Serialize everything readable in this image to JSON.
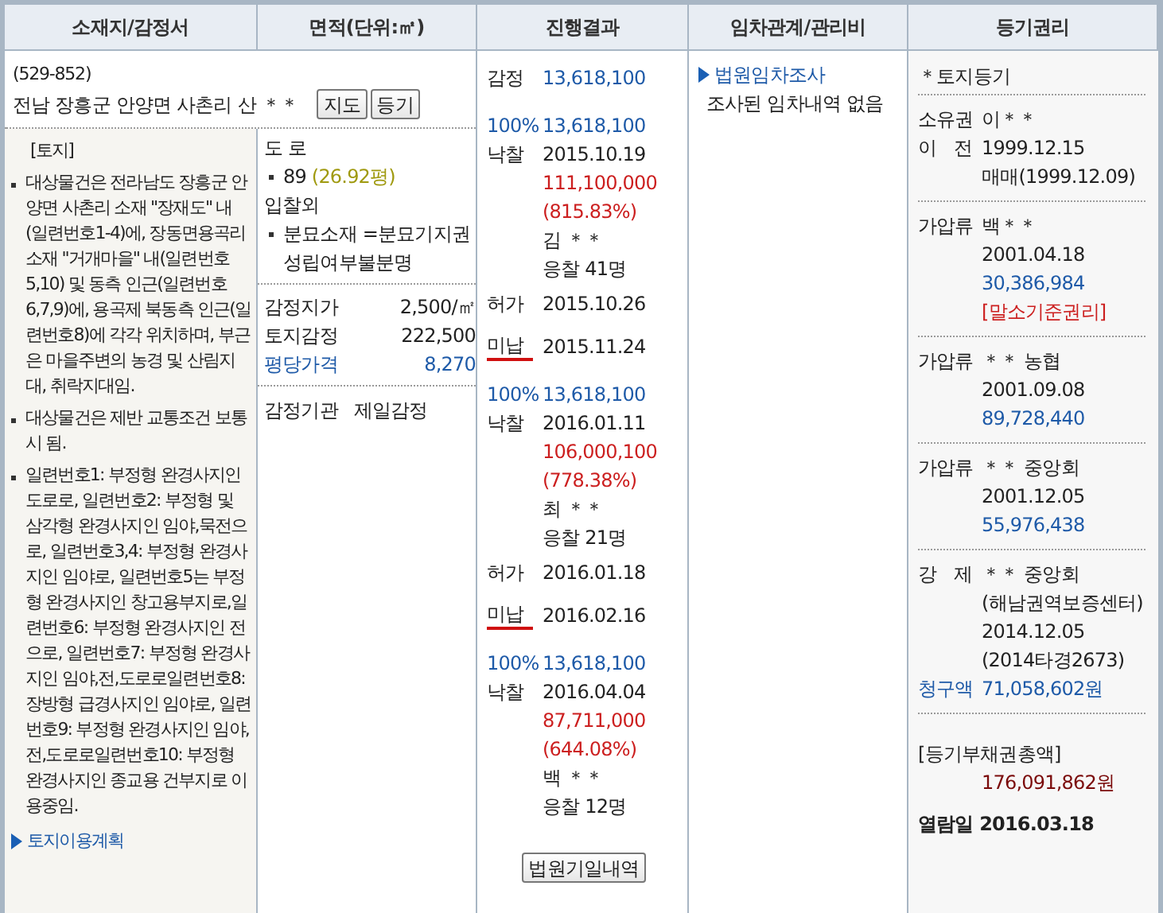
{
  "columns": [
    "소재지/감정서",
    "면적(단위:㎡)",
    "진행결과",
    "임차관계/관리비",
    "등기권리"
  ],
  "address": {
    "zip": "(529-852)",
    "text": "전남 장흥군 안양면 사촌리 산 ＊＊",
    "buttons": [
      "지도",
      "등기"
    ]
  },
  "land": {
    "heading": "[토지]",
    "bullets": [
      "대상물건은 전라남도 장흥군 안양면 사촌리 소재 \"장재도\" 내(일련번호1-4)에, 장동면용곡리 소재 \"거개마을\" 내(일련번호5,10) 및 동측 인근(일련번호6,7,9)에, 용곡제 북동측 인근(일련번호8)에 각각 위치하며, 부근은 마을주변의 농경 및 산림지대, 취락지대임.",
      "대상물건은 제반 교통조건 보통시 됨.",
      "일련번호1: 부정형 완경사지인 도로로, 일련번호2: 부정형 및 삼각형 완경사지인 임야,묵전으로, 일련번호3,4: 부정형 완경사지인 임야로, 일련번호5는 부정형 완경사지인 창고용부지로,일련번호6: 부정형 완경사지인 전으로, 일련번호7: 부정형 완경사지인 임야,전,도로로일련번호8: 장방형 급경사지인 임야로, 일련번호9: 부정형 완경사지인 임야,전,도로로일련번호10: 부정형 완경사지인 종교용 건부지로 이용중임."
    ],
    "link": "토지이용계획"
  },
  "area": {
    "groups": [
      {
        "label": "도 로",
        "items": [
          {
            "text": "89",
            "pyeong": "(26.92평)"
          }
        ]
      },
      {
        "label": "입찰외",
        "items": [
          {
            "text": "분묘소재 =분묘기지권성립여부불분명"
          }
        ]
      }
    ],
    "appraisal": [
      {
        "label": "감정지가",
        "value": "2,500/㎡",
        "kind": "plain"
      },
      {
        "label": "토지감정",
        "value": "222,500",
        "kind": "plain"
      },
      {
        "label": "평당가격",
        "value": "8,270",
        "kind": "highlight"
      }
    ],
    "agency": {
      "label": "감정기관",
      "value": "제일감정"
    }
  },
  "progress": {
    "items": [
      {
        "kind": "appraisal",
        "label": "감정",
        "value": "13,618,100"
      },
      {
        "kind": "round",
        "percent": "100%",
        "minimum": "13,618,100",
        "label": "낙찰",
        "date": "2015.10.19",
        "bid": "111,100,000",
        "ratio": "(815.83%)",
        "winner": "김 ＊＊",
        "bidders": "응찰 41명"
      },
      {
        "kind": "event",
        "label": "허가",
        "date": "2015.10.26",
        "unpaid": false
      },
      {
        "kind": "event",
        "label": "미납",
        "date": "2015.11.24",
        "unpaid": true
      },
      {
        "kind": "round",
        "percent": "100%",
        "minimum": "13,618,100",
        "label": "낙찰",
        "date": "2016.01.11",
        "bid": "106,000,100",
        "ratio": "(778.38%)",
        "winner": "최 ＊＊",
        "bidders": "응찰 21명"
      },
      {
        "kind": "event",
        "label": "허가",
        "date": "2016.01.18",
        "unpaid": false
      },
      {
        "kind": "event",
        "label": "미납",
        "date": "2016.02.16",
        "unpaid": true
      },
      {
        "kind": "round",
        "percent": "100%",
        "minimum": "13,618,100",
        "label": "낙찰",
        "date": "2016.04.04",
        "bid": "87,711,000",
        "ratio": "(644.08%)",
        "winner": "백 ＊＊",
        "bidders": "응찰 12명"
      }
    ],
    "button": "법원기일내역"
  },
  "tenant": {
    "link": "법원임차조사",
    "note": "조사된 임차내역 없음"
  },
  "registry": {
    "title": "＊토지등기",
    "entries": [
      {
        "rows": [
          {
            "label": "소유권",
            "text": "이＊＊",
            "kind": "plain"
          },
          {
            "label": "이 전",
            "text": "1999.12.15",
            "kind": "plain"
          },
          {
            "text": "매매(1999.12.09)",
            "kind": "plain"
          }
        ]
      },
      {
        "rows": [
          {
            "label": "가압류",
            "text": "백＊＊",
            "kind": "plain"
          },
          {
            "text": "2001.04.18",
            "kind": "plain"
          },
          {
            "text": "30,386,984",
            "kind": "amount"
          },
          {
            "text": "[말소기준권리]",
            "kind": "warning"
          }
        ]
      },
      {
        "rows": [
          {
            "label": "가압류",
            "text": "＊＊ 농협",
            "kind": "plain"
          },
          {
            "text": "2001.09.08",
            "kind": "plain"
          },
          {
            "text": "89,728,440",
            "kind": "amount"
          }
        ]
      },
      {
        "rows": [
          {
            "label": "가압류",
            "text": "＊＊ 중앙회",
            "kind": "plain"
          },
          {
            "text": "2001.12.05",
            "kind": "plain"
          },
          {
            "text": "55,976,438",
            "kind": "amount"
          }
        ]
      },
      {
        "rows": [
          {
            "label": "강 제",
            "text": "＊＊ 중앙회",
            "kind": "plain"
          },
          {
            "text": "(해남권역보증센터)",
            "kind": "plain"
          },
          {
            "text": "2014.12.05",
            "kind": "plain"
          },
          {
            "text": "(2014타경2673)",
            "kind": "plain"
          },
          {
            "label": "청구액",
            "text": "71,058,602원",
            "kind": "amount"
          }
        ]
      }
    ],
    "total_label": "[등기부채권총액]",
    "total": "176,091,862원",
    "viewed": "열람일 2016.03.18"
  }
}
